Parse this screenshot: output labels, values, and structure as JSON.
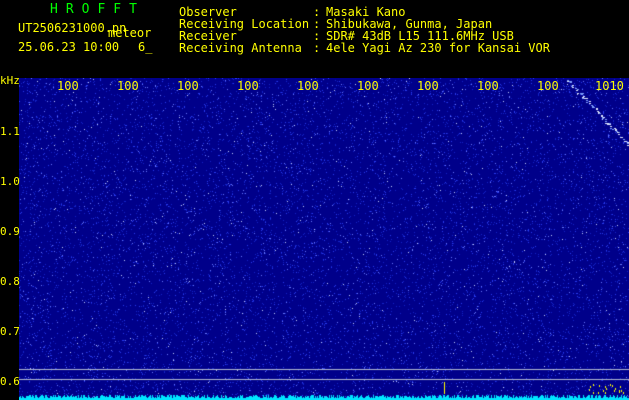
{
  "header": {
    "app_title": "HROFFT",
    "file_name": "UT2506231000.pn",
    "tag": "meteor",
    "datetime": "25.06.23 10:00",
    "count": "6_",
    "info": [
      {
        "label": "Observer",
        "value": "Masaki Kano"
      },
      {
        "label": "Receiving Location",
        "value": "Shibukawa, Gunma, Japan"
      },
      {
        "label": "Receiver",
        "value": "SDR# 43dB L15 111.6MHz USB"
      },
      {
        "label": "Receiving Antenna",
        "value": "4ele Yagi Az 230 for Kansai VOR"
      }
    ]
  },
  "plot": {
    "y_unit": "kHz",
    "y_ticks": [
      "1.1",
      "1.0",
      "0.9",
      "0.8",
      "0.7",
      "0.6"
    ],
    "x_ticks": [
      "100",
      "100",
      "100",
      "100",
      "100",
      "100",
      "100",
      "100",
      "100",
      "1010"
    ],
    "colors": {
      "background": "#00008a",
      "noise": "#6a7aff",
      "baseline": "#00e5ff",
      "label": "#ffff00",
      "title": "#00ff00"
    }
  }
}
